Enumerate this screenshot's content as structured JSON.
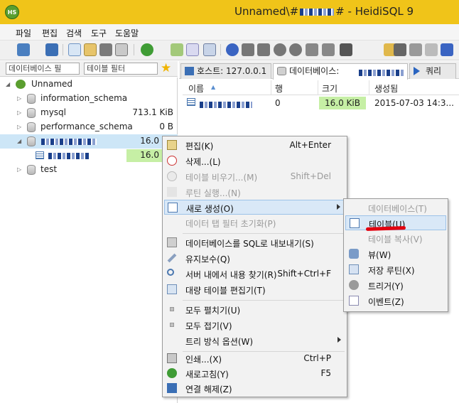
{
  "window": {
    "title": "Unnamed\\#",
    "title_suffix": "# - HeidiSQL 9",
    "app_icon_text": "HS",
    "colors": {
      "titlebar": "#f0c419",
      "selection": "#cde6f7",
      "size_bar": "#c6efa5",
      "menu_highlight": "#d9e8f7",
      "annotation": "#e3000f"
    }
  },
  "menubar": {
    "items": [
      "파일",
      "편집",
      "검색",
      "도구",
      "도움말"
    ]
  },
  "toolbar": {
    "icons": [
      "connect-icon",
      "disconnect-icon",
      "copy-icon",
      "paste-icon",
      "undo-icon",
      "print-icon",
      "refresh-icon",
      "export-icon",
      "import-icon",
      "help-icon",
      "first-icon",
      "last-icon",
      "add-icon",
      "remove-icon",
      "apply-icon",
      "cancel-icon",
      "run-icon",
      "folder-icon",
      "save-icon",
      "grid-icon",
      "format-icon"
    ]
  },
  "filters": {
    "database_filter": "데이터베이스 필",
    "table_filter": "테이블 필터"
  },
  "tree": {
    "root": "Unnamed",
    "items": [
      {
        "name": "information_schema",
        "size": ""
      },
      {
        "name": "mysql",
        "size": "713.1 KiB"
      },
      {
        "name": "performance_schema",
        "size": "0 B"
      },
      {
        "name": "",
        "size": "16.0"
      },
      {
        "name": "",
        "size": "16.0"
      },
      {
        "name": "test",
        "size": ""
      }
    ]
  },
  "tabs": [
    {
      "label": "호스트: 127.0.0.1"
    },
    {
      "label": "데이터베이스:"
    },
    {
      "label": "쿼리"
    }
  ],
  "grid": {
    "columns": [
      "이름",
      "행",
      "크기",
      "생성됨"
    ],
    "sort_indicator": "▲",
    "rows": [
      {
        "name": "",
        "rows": "0",
        "size": "16.0 KiB",
        "created": "2015-07-03 14:3..."
      }
    ]
  },
  "context_menu": {
    "items": [
      {
        "label": "편집(K)",
        "shortcut": "Alt+Enter",
        "disabled": false,
        "icon": "edit-icon"
      },
      {
        "label": "삭제...(L)",
        "shortcut": "",
        "disabled": false,
        "icon": "delete-icon"
      },
      {
        "label": "테이블 비우기...(M)",
        "shortcut": "Shift+Del",
        "disabled": true,
        "icon": "empty-table-icon"
      },
      {
        "label": "루틴 실행...(N)",
        "shortcut": "",
        "disabled": true,
        "icon": "run-routine-icon"
      },
      {
        "label": "새로 생성(O)",
        "shortcut": "",
        "disabled": false,
        "icon": "new-icon"
      },
      {
        "label": "데이터 탭 필터 초기화(P)",
        "shortcut": "",
        "disabled": true,
        "icon": ""
      },
      {
        "label": "데이터베이스를 SQL로 내보내기(S)",
        "shortcut": "",
        "disabled": false,
        "icon": "export-sql-icon"
      },
      {
        "label": "유지보수(Q)",
        "shortcut": "",
        "disabled": false,
        "icon": "maintenance-icon"
      },
      {
        "label": "서버 내에서 내용 찾기(R)",
        "shortcut": "Shift+Ctrl+F",
        "disabled": false,
        "icon": "search-icon"
      },
      {
        "label": "대량 테이블 편집기(T)",
        "shortcut": "",
        "disabled": false,
        "icon": "bulk-edit-icon"
      },
      {
        "label": "모두 펼치기(U)",
        "shortcut": "",
        "disabled": false,
        "icon": ""
      },
      {
        "label": "모두 접기(V)",
        "shortcut": "",
        "disabled": false,
        "icon": ""
      },
      {
        "label": "트리 방식 옵션(W)",
        "shortcut": "",
        "disabled": false,
        "icon": ""
      },
      {
        "label": "인쇄...(X)",
        "shortcut": "Ctrl+P",
        "disabled": false,
        "icon": "print-icon"
      },
      {
        "label": "새로고침(Y)",
        "shortcut": "F5",
        "disabled": false,
        "icon": "refresh-icon"
      },
      {
        "label": "연결 해제(Z)",
        "shortcut": "",
        "disabled": false,
        "icon": "disconnect-icon"
      }
    ]
  },
  "submenu": {
    "items": [
      {
        "label": "데이터베이스(T)",
        "disabled": true,
        "icon": ""
      },
      {
        "label": "테이블(U)",
        "disabled": false,
        "icon": "table-icon"
      },
      {
        "label": "테이블 복사(V)",
        "disabled": true,
        "icon": ""
      },
      {
        "label": "뷰(W)",
        "disabled": false,
        "icon": "view-icon"
      },
      {
        "label": "저장 루틴(X)",
        "disabled": false,
        "icon": "stored-routine-icon"
      },
      {
        "label": "트리거(Y)",
        "disabled": false,
        "icon": "trigger-icon"
      },
      {
        "label": "이벤트(Z)",
        "disabled": false,
        "icon": "event-icon"
      }
    ]
  }
}
